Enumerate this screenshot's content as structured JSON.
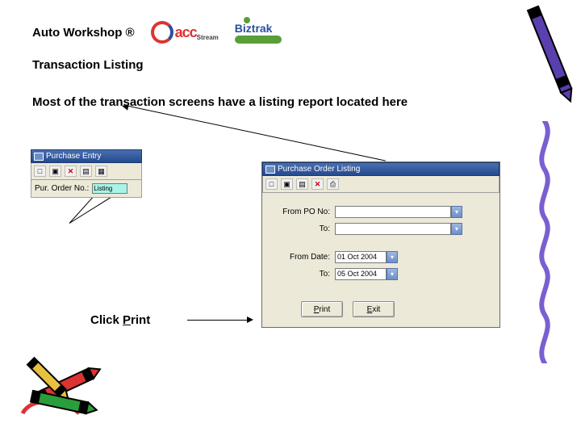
{
  "header": {
    "app_title": "Auto Workshop ®",
    "logos": {
      "acc_name": "acc",
      "acc_sub": "Stream",
      "biztrak": "Biztrak"
    }
  },
  "section_heading": "Transaction Listing",
  "body_text": "Most of the transaction screens have a listing report located here",
  "click_print_prefix": "Click ",
  "click_print_letter": "P",
  "click_print_rest": "rint",
  "purchase_entry": {
    "title": "Purchase Entry",
    "toolbar_icons": [
      "new-doc-icon",
      "open-icon",
      "delete-x-icon",
      "save-icon",
      "grid-icon"
    ],
    "field_label": "Pur. Order No.:",
    "field_value": "Listing"
  },
  "po_listing": {
    "title": "Purchase Order Listing",
    "toolbar_icons": [
      "new-doc-icon",
      "open-icon",
      "save-icon",
      "delete-x-icon",
      "print-icon"
    ],
    "fields": {
      "from_po_label": "From PO No:",
      "from_po_value": "",
      "to_po_label": "To:",
      "to_po_value": "",
      "from_date_label": "From Date:",
      "from_date_value": "01 Oct 2004",
      "to_date_label": "To:",
      "to_date_value": "05 Oct 2004"
    },
    "buttons": {
      "print_u": "P",
      "print_rest": "rint",
      "exit_u": "E",
      "exit_rest": "xit"
    }
  }
}
